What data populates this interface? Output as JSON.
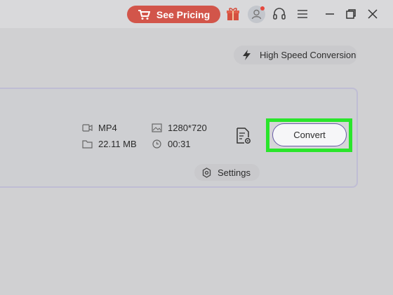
{
  "titlebar": {
    "pricing_label": "See Pricing"
  },
  "toolbar": {
    "high_speed_label": "High Speed Conversion"
  },
  "file": {
    "format": "MP4",
    "size": "22.11 MB",
    "resolution": "1280*720",
    "duration": "00:31"
  },
  "actions": {
    "convert_label": "Convert",
    "settings_label": "Settings"
  },
  "colors": {
    "pricing_bg": "#d2554a",
    "highlight_border": "#29e52b",
    "convert_border": "#6a5ca8"
  }
}
